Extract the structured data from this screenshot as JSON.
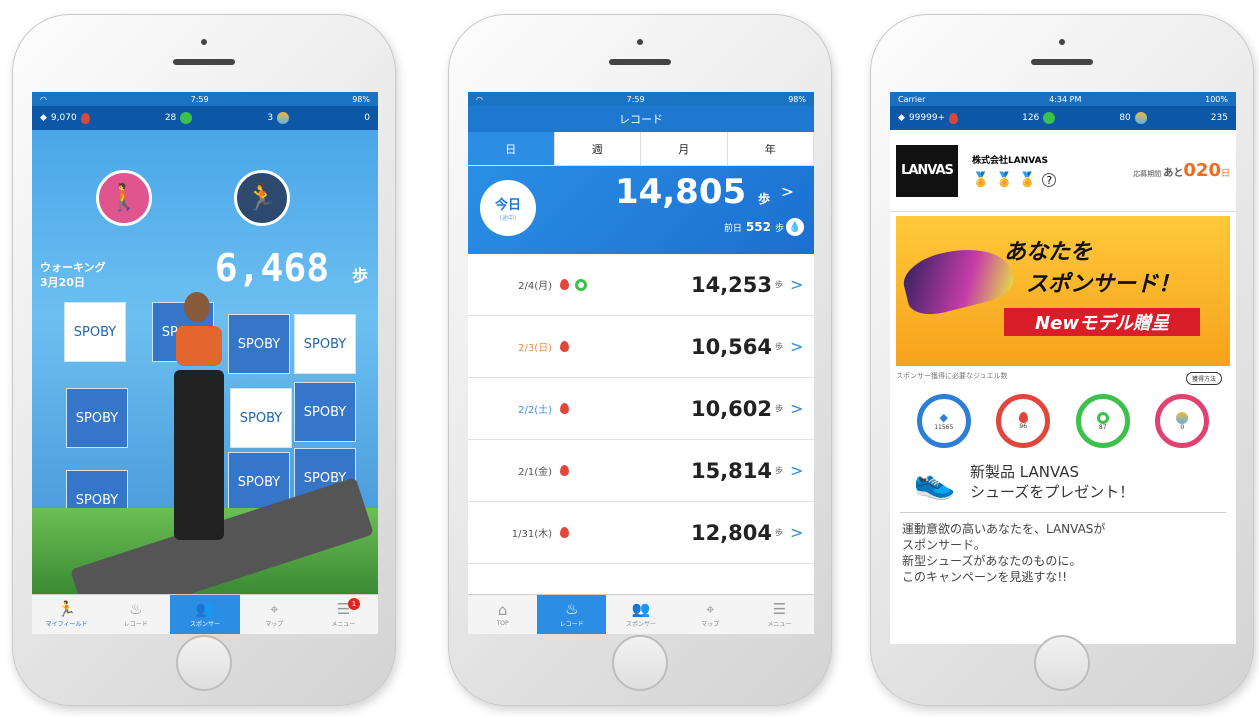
{
  "phone1": {
    "status": {
      "time": "7:59",
      "battery": "98%"
    },
    "gems": {
      "diamond": "9,070",
      "red": "28",
      "green": "3",
      "multi": "0"
    },
    "walking_label": "ウォーキング",
    "date": "3月20日",
    "steps": "6,468",
    "steps_unit": "歩",
    "panel_text": "SPOBY",
    "tabs": [
      "マイフィールド",
      "レコード",
      "スポンサー",
      "マップ",
      "メニュー"
    ],
    "menu_badge": "1"
  },
  "phone2": {
    "status": {
      "time": "7:59",
      "battery": "98%"
    },
    "title": "レコード",
    "periods": [
      "日",
      "週",
      "月",
      "年"
    ],
    "today_label": "今日",
    "today_sub": "(途中)",
    "today_steps": "14,805",
    "unit": "歩",
    "prev_label": "前日",
    "prev_steps": "552",
    "records": [
      {
        "date": "2/4(月)",
        "steps": "14,253",
        "kind": "normal",
        "green": true
      },
      {
        "date": "2/3(日)",
        "steps": "10,564",
        "kind": "sun",
        "green": false
      },
      {
        "date": "2/2(土)",
        "steps": "10,602",
        "kind": "sat",
        "green": false
      },
      {
        "date": "2/1(金)",
        "steps": "15,814",
        "kind": "normal",
        "green": false
      },
      {
        "date": "1/31(木)",
        "steps": "12,804",
        "kind": "normal",
        "green": false
      }
    ],
    "tabs": [
      "TOP",
      "レコード",
      "スポンサー",
      "マップ",
      "メニュー"
    ]
  },
  "phone3": {
    "status": {
      "carrier": "Carrier",
      "time": "4:34 PM",
      "battery": "100%"
    },
    "gems": {
      "diamond": "99999+",
      "red": "126",
      "green": "80",
      "multi": "235"
    },
    "logo": "LANVAS",
    "company": "株式会社LANVAS",
    "period_label": "応募期間",
    "remain_prefix": "あと",
    "remain_days": "020",
    "remain_unit": "日",
    "banner": {
      "line1": "あなたを",
      "line2": "スポンサード！",
      "line3": "Newモデル贈呈"
    },
    "required_gems_label": "スポンサー獲得に必要なジュエル数",
    "howto": "獲得方法",
    "rings": [
      {
        "value": "11565",
        "color": "#2c7ed6"
      },
      {
        "value": "96",
        "color": "#e2453a"
      },
      {
        "value": "87",
        "color": "#3cc24a"
      },
      {
        "value": "0",
        "color": "#e0416e"
      }
    ],
    "present": {
      "line1": "新製品 LANVAS",
      "line2": "シューズをプレゼント！"
    },
    "description": [
      "運動意欲の高いあなたを、LANVASが",
      "スポンサード。",
      "新型シューズがあなたのものに。",
      "このキャンペーンを見逃すな!!"
    ]
  }
}
